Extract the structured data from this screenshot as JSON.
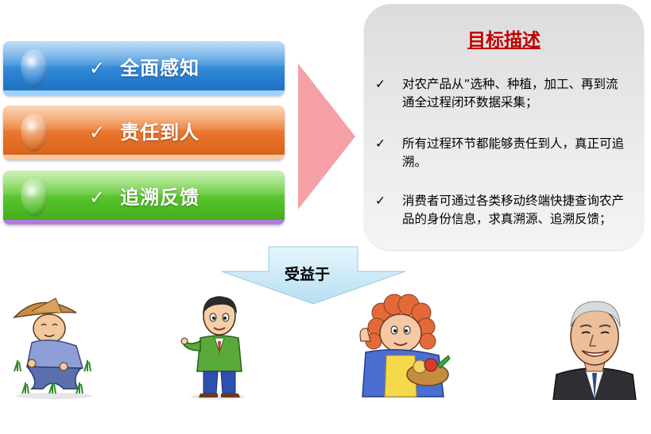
{
  "bars": [
    {
      "check": "✓",
      "label": "全面感知",
      "color": "#2f86d6"
    },
    {
      "check": "✓",
      "label": "责任到人",
      "color": "#e8732a"
    },
    {
      "check": "✓",
      "label": "追溯反馈",
      "color": "#54c22a"
    }
  ],
  "panel": {
    "title": "目标描述",
    "items": [
      {
        "check": "✓",
        "text": "对农产品从”选种、种植，加工、再到流通全过程闭环数据采集；"
      },
      {
        "check": "✓",
        "text": "所有过程环节都能够责任到人，真正可追溯。"
      },
      {
        "check": "✓",
        "text": "消费者可通过各类移动终端快捷查询农产品的身份信息，求真溯源、追溯反馈；"
      }
    ]
  },
  "beneficiary_label": "受益于",
  "beneficiaries": [
    "farmer-icon",
    "businessman-icon",
    "consumer-icon",
    "executive-icon"
  ],
  "colors": {
    "title": "#c00000",
    "arrow_pink": "#f5a0a6",
    "arrow_blue": "#c6e7f7"
  }
}
